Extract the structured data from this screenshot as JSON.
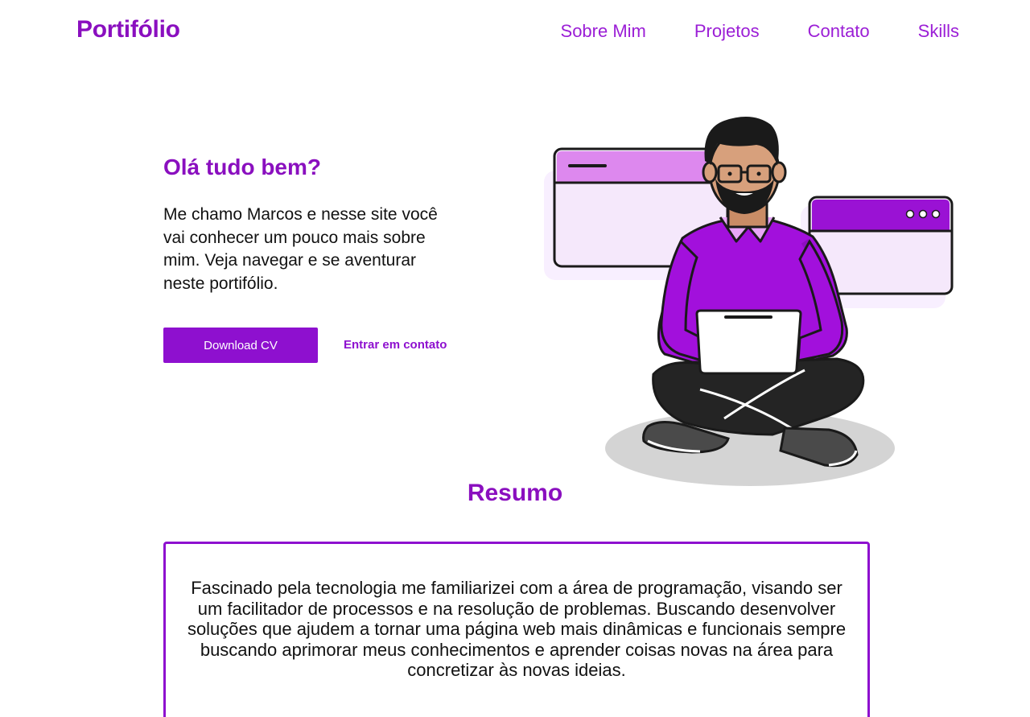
{
  "header": {
    "brand": "Portifólio",
    "nav": [
      "Sobre Mim",
      "Projetos",
      "Contato",
      "Skills"
    ]
  },
  "hero": {
    "title": "Olá tudo bem?",
    "text": "Me chamo Marcos e nesse site você vai conhecer um pouco mais sobre mim. Veja navegar e se aventurar neste portifólio.",
    "primary_button": "Download CV",
    "secondary_link": "Entrar em contato"
  },
  "resumo": {
    "title": "Resumo",
    "text": "Fascinado pela tecnologia me familiarizei com a área de programação, visando ser um facilitador de processos e na resolução de problemas. Buscando desenvolver soluções que ajudem a tornar uma página web mais dinâmicas e funcionais sempre buscando aprimorar meus conhecimentos e aprender coisas novas na área para concretizar às novas ideias."
  },
  "colors": {
    "accent": "#8a0fbf",
    "button": "#8e10cf",
    "light_purple": "#dd88ee",
    "pale_purple": "#f8efff"
  },
  "illustration": "man-sitting-with-laptop-illustration"
}
